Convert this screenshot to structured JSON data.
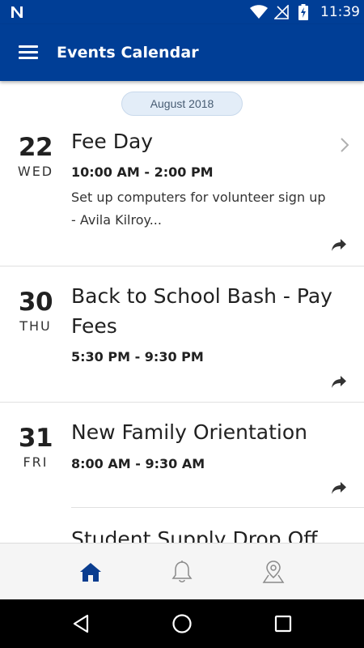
{
  "status_bar": {
    "time": "11:39",
    "icons": [
      "n-logo-icon",
      "wifi-icon",
      "signal-off-icon",
      "battery-charging-icon"
    ]
  },
  "app_bar": {
    "title": "Events Calendar",
    "menu_icon": "hamburger-menu-icon"
  },
  "month_header": "August 2018",
  "events": [
    {
      "day_number": "22",
      "weekday": "WED",
      "title": "Fee Day",
      "time": "10:00 AM - 2:00 PM",
      "description_line1": "Set up computers for volunteer sign up",
      "description_line2": "- Avila Kilroy...",
      "has_chevron": true
    },
    {
      "day_number": "30",
      "weekday": "THU",
      "title_line1": "Back to School Bash - Pay",
      "title_line2": "Fees",
      "time": "5:30 PM - 9:30 PM"
    },
    {
      "day_number": "31",
      "weekday": "FRI",
      "title": "New Family Orientation",
      "time": "8:00 AM - 9:30 AM"
    },
    {
      "title": "Student Supply Drop Off"
    }
  ],
  "bottom_nav": {
    "items": [
      {
        "name": "home",
        "icon": "home-icon",
        "active": true
      },
      {
        "name": "notifications",
        "icon": "bell-icon",
        "active": false
      },
      {
        "name": "locations",
        "icon": "map-pin-icon",
        "active": false
      }
    ],
    "active_color": "#0a3d8f",
    "inactive_color": "#8a8a8a"
  },
  "system_nav": {
    "icons": [
      "back-icon",
      "home-circle-icon",
      "recents-icon"
    ]
  },
  "colors": {
    "primary": "#003e96",
    "pill_bg": "#e3edf8",
    "pill_text": "#475c73"
  }
}
